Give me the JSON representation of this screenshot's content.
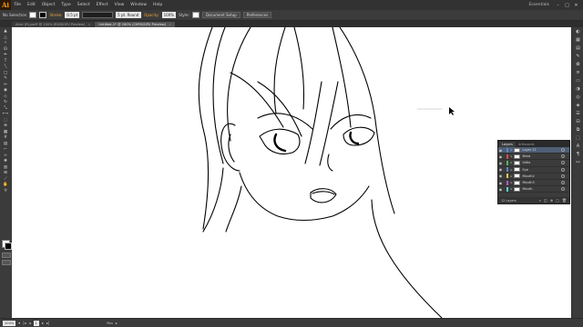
{
  "menubar": {
    "logo": "Ai",
    "items": [
      "File",
      "Edit",
      "Object",
      "Type",
      "Select",
      "Effect",
      "View",
      "Window",
      "Help"
    ],
    "workspace": "Essentials",
    "window_buttons": [
      "–",
      "□",
      "✕"
    ]
  },
  "control_bar": {
    "selection_label": "No Selection",
    "stroke_label": "Stroke:",
    "stroke_value": "0.5 pt",
    "brush_label": "5 pt. Round",
    "opacity_label": "Opacity:",
    "opacity_value": "100%",
    "style_label": "Style:",
    "document_setup": "Document Setup",
    "preferences": "Preferences"
  },
  "tabs": [
    {
      "label": "Alice (R).psd* @ 100% (RGB/GPU Preview)",
      "active": false
    },
    {
      "label": "Untitled-1* @ 200% (CMYK/GPU Preview)",
      "active": true
    }
  ],
  "tools": [
    {
      "name": "selection-tool",
      "glyph": "▲"
    },
    {
      "name": "direct-selection-tool",
      "glyph": "△"
    },
    {
      "name": "magic-wand-tool",
      "glyph": "✧"
    },
    {
      "name": "lasso-tool",
      "glyph": "ᘏ"
    },
    {
      "name": "pen-tool",
      "glyph": "✒"
    },
    {
      "name": "type-tool",
      "glyph": "T"
    },
    {
      "name": "line-tool",
      "glyph": "╲"
    },
    {
      "name": "rectangle-tool",
      "glyph": "□"
    },
    {
      "name": "paintbrush-tool",
      "glyph": "✎"
    },
    {
      "name": "pencil-tool",
      "glyph": "✏"
    },
    {
      "name": "blob-brush-tool",
      "glyph": "◉"
    },
    {
      "name": "eraser-tool",
      "glyph": "◇"
    },
    {
      "name": "rotate-tool",
      "glyph": "↻"
    },
    {
      "name": "scale-tool",
      "glyph": "⤡"
    },
    {
      "name": "width-tool",
      "glyph": "⟷"
    },
    {
      "name": "free-transform-tool",
      "glyph": "⬚"
    },
    {
      "name": "shape-builder-tool",
      "glyph": "⊕"
    },
    {
      "name": "perspective-grid-tool",
      "glyph": "▦"
    },
    {
      "name": "mesh-tool",
      "glyph": "#"
    },
    {
      "name": "gradient-tool",
      "glyph": "▤"
    },
    {
      "name": "eyedropper-tool",
      "glyph": "⌐"
    },
    {
      "name": "blend-tool",
      "glyph": "∞"
    },
    {
      "name": "symbol-sprayer-tool",
      "glyph": "✺"
    },
    {
      "name": "column-graph-tool",
      "glyph": "▥"
    },
    {
      "name": "artboard-tool",
      "glyph": "⊞"
    },
    {
      "name": "slice-tool",
      "glyph": "⟋"
    },
    {
      "name": "hand-tool",
      "glyph": "✋"
    },
    {
      "name": "zoom-tool",
      "glyph": "⚲"
    }
  ],
  "layers_panel": {
    "tabs": [
      "Layers",
      "Artboards"
    ],
    "rows": [
      {
        "name": "Layer 11",
        "color": "#4f8ad8",
        "selected": true
      },
      {
        "name": "Brow",
        "color": "#e04848",
        "selected": false
      },
      {
        "name": "Iditio",
        "color": "#4bbf4b",
        "selected": false
      },
      {
        "name": "Eye",
        "color": "#4f8ad8",
        "selected": false
      },
      {
        "name": "Mouth2",
        "color": "#e0d13a",
        "selected": false
      },
      {
        "name": "Mouth3",
        "color": "#c44fd8",
        "selected": false
      },
      {
        "name": "Mouth",
        "color": "#4bd8d8",
        "selected": false
      }
    ],
    "footer_text": "12 Layers"
  },
  "status_bar": {
    "zoom": "200%",
    "artboard": "1",
    "mode": "Pen"
  },
  "dock_icons": [
    "color-icon",
    "color-guide-icon",
    "swatches-icon",
    "brushes-icon",
    "symbols-icon",
    "stroke-icon",
    "gradient-icon",
    "transparency-icon",
    "appearance-icon",
    "graphic-styles-icon",
    "layers-icon",
    "align-icon",
    "pathfinder-icon",
    "transform-icon",
    "character-icon",
    "paragraph-icon",
    "links-icon"
  ]
}
